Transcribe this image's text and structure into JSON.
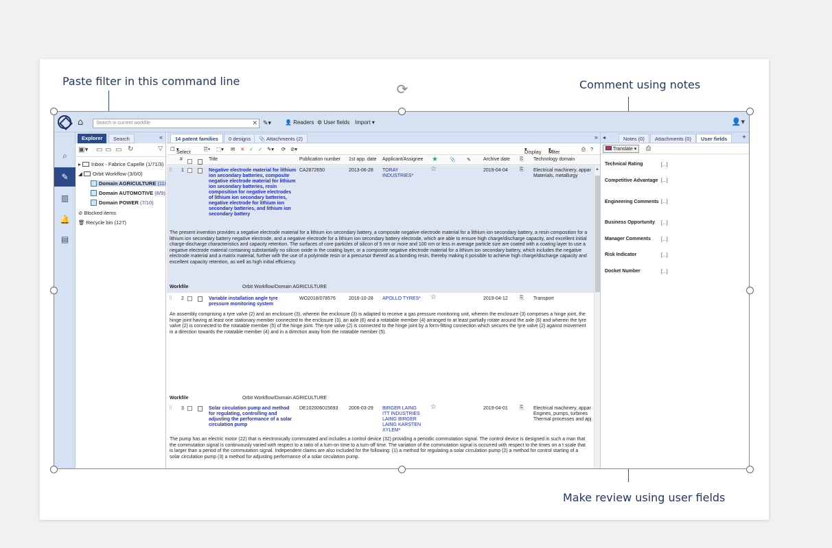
{
  "callouts": {
    "paste_filter": "Paste filter in this command line",
    "comment_notes": "Comment using notes",
    "review_fields": "Make review using user fields"
  },
  "topbar": {
    "search_placeholder": "Search in current workfile",
    "readers": "Readers",
    "user_fields": "User fields",
    "import": "Import"
  },
  "left_panel": {
    "tabs": [
      "Explorer",
      "Search"
    ],
    "tree": [
      {
        "label": "Inbox - Fabrice Capelle",
        "count": "(1/71/3)"
      },
      {
        "label": "Orbit Workflow",
        "count": "(3/0/0)"
      },
      {
        "label": "Domain AGRICULTURE",
        "count": "(11/"
      },
      {
        "label": "Domain AUTOMOTIVE",
        "count": "(8/9)"
      },
      {
        "label": "Domain POWER",
        "count": "(7/10)"
      },
      {
        "label": "Blocked items",
        "count": ""
      },
      {
        "label": "Recycle bin",
        "count": "(127)"
      }
    ]
  },
  "main": {
    "tabs": [
      "14 patent families",
      "0 designs",
      "Attachments (2)"
    ],
    "toolbar": {
      "select": "Select",
      "display": "Display",
      "filter": "Filter"
    },
    "columns": [
      "#",
      "Title",
      "Publication number",
      "1st app. date",
      "Applicant/Assignee",
      "Archive date",
      "Technology domain"
    ],
    "rows": [
      {
        "num": "1",
        "title": "Negative electrode material for lithium ion secondary batteries, composite negative electrode material for lithium ion secondary batteries, resin composition for negative electrodes of lithium ion secondary batteries, negative electrode for lithium ion secondary batteries, and lithium ion secondary battery",
        "pub": "CA2872650",
        "date": "2013-06-28",
        "applicant": "TORAY INDUSTRIES*",
        "archive": "2019-04-04",
        "tech": "Electrical machinery, appar Materials, metallurgy",
        "abstract": "The present invention provides a negative electrode material for a lithium ion secondary battery, a composite negative electrode material for a lithium ion secondary battery, a resin composition for a lithium ion secondary battery negative electrode, and a negative electrode for a lithium ion secondary battery electrode, which are able to ensure high charge/discharge capacity, and excellent initial charge-discharge characteristics and capacity retention. The surfaces of core particles of silicon of 5 nm or more and 100 nm or less in average particle size are coated with a coating layer to use a negative electrode material containing substantially no silicon oxide in the coating layer, or a composite negative electrode material for a lithium ion secondary battery, which includes the negative electrode material and a matrix material, further with the use of a polyimide resin or a precursor thereof as a bonding resin, thereby making it possible to achieve high charge/discharge capacity and excellent capacity retention, as well as high initial efficiency.",
        "workfile_label": "Workfile",
        "workfile": "Orbit Workflow/Domain AGRICULTURE"
      },
      {
        "num": "2",
        "title": "Variable installation angle tyre pressure monitoring system",
        "pub": "WO2018/078576",
        "date": "2016-10-28",
        "applicant": "APOLLO TYRES*",
        "archive": "2019-04-12",
        "tech": "Transport",
        "abstract": "An assembly comprising a tyre valve (2) and an enclosure (3), wherein the enclosure (3) is adapted to receive a gas pressure monitoring unit, wherein the enclosure (3) comprises a hinge joint, the hinge joint having at least one stationary member connected to the enclosure (3), an axle (6) and a rotatable member (4) arranged to at least partially rotate around the axle (6) and wherein the tyre valve (2) is connected to the rotatable member (5) of the hinge joint. The tyre valve (2) is connected to the hinge joint by a form-fitting connection which secures the tyre valve (2) against movement in a direction towards the rotatable member (4) and in a direction away from the rotatable member (5).",
        "workfile_label": "Workfile",
        "workfile": "Orbit Workflow/Domain AGRICULTURE"
      },
      {
        "num": "3",
        "title": "Solar circulation pump and method for regulating, controlling and adjusting the performance of a solar circulation pump",
        "pub": "DE102006015693",
        "date": "2006-03-29",
        "applicant": "BIRGER LAING ITT INDUSTRIES LAING BIRGER LAING KARSTEN XYLEM*",
        "archive": "2019-04-01",
        "tech": "Electrical machinery, appar Engines, pumps, turbines Thermal processes and apj",
        "abstract": "The pump has an electric motor (22) that is electronically commutated and includes a control device (32) providing a periodic commutation signal. The control device is designed in such a man that the commutation signal is continuously varied with respect to a ratio of a turn-on time to a turn-off time. The variation of the commutation signal is occurred with respect to the times on a t scale that is larger than a period of the commutation signal. Independent claims are also included for the following: (1) a method for regulating a solar circulation pump (2) a method for control starting of a solar circulation pump (3) a method for adjusting performance of a solar circulation pump."
      }
    ]
  },
  "side": {
    "tabs": [
      "Notes (0)",
      "Attachments (0)",
      "User fields"
    ],
    "translate": "Translate",
    "fields": [
      {
        "label": "Technical Rating",
        "value": "[...]"
      },
      {
        "label": "Competitive Advantage",
        "value": "[...]"
      },
      {
        "label": "Engineering Comments",
        "value": "[...]"
      },
      {
        "label": "Business Opportunity",
        "value": "[...]"
      },
      {
        "label": "Manager Comments",
        "value": "[...]"
      },
      {
        "label": "Risk Indicator",
        "value": "[...]"
      },
      {
        "label": "Docket Number",
        "value": "[...]"
      }
    ]
  }
}
